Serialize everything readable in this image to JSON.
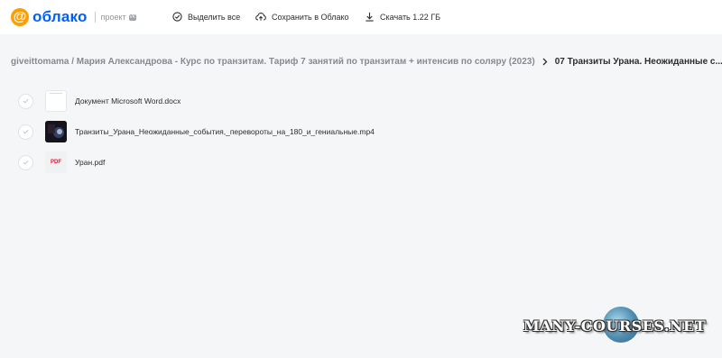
{
  "header": {
    "logo_symbol": "@",
    "logo_text": "облако",
    "project_label": "проект",
    "project_badge": "VK",
    "actions": {
      "select_all": "Выделить все",
      "save_to_cloud": "Сохранить в Облако",
      "download": "Скачать 1.22 ГБ"
    }
  },
  "breadcrumb": {
    "path": "giveittomama / Мария Александрова - Курс по транзитам. Тариф 7 занятий по транзитам + интенсив по соляру (2023)",
    "current": "07 Транзиты Урана. Неожиданные с..."
  },
  "files": [
    {
      "name": "Документ Microsoft Word.docx",
      "type": "doc"
    },
    {
      "name": "Транзиты_Урана_Неожиданные_события,_перевороты_на_180_и_гениальные.mp4",
      "type": "video"
    },
    {
      "name": "Уран.pdf",
      "type": "pdf",
      "thumb_label": "PDF"
    }
  ],
  "watermark": "MANY-COURSES.NET",
  "colors": {
    "brand_blue": "#005ff9",
    "brand_orange": "#ff9e00",
    "pdf_red": "#ed0a34"
  }
}
